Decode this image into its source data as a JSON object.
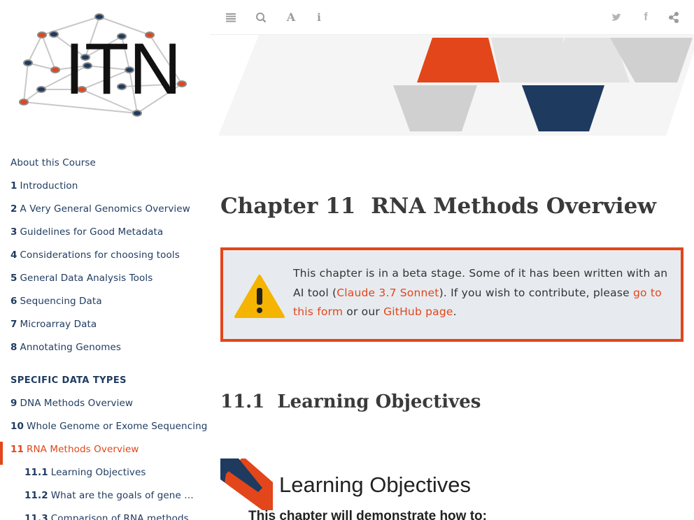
{
  "logo": {
    "text": "ITN"
  },
  "toolbar": {
    "icons": [
      "menu-icon",
      "search-icon",
      "font-icon",
      "info-icon",
      "twitter-icon",
      "facebook-icon",
      "share-icon"
    ],
    "font_glyph": "A",
    "info_glyph": "i",
    "facebook_glyph": "f"
  },
  "toc": {
    "about": "About this Course",
    "items": [
      {
        "num": "1",
        "label": "Introduction"
      },
      {
        "num": "2",
        "label": "A Very General Genomics Overview"
      },
      {
        "num": "3",
        "label": "Guidelines for Good Metadata"
      },
      {
        "num": "4",
        "label": "Considerations for choosing tools"
      },
      {
        "num": "5",
        "label": "General Data Analysis Tools"
      },
      {
        "num": "6",
        "label": "Sequencing Data"
      },
      {
        "num": "7",
        "label": "Microarray Data"
      },
      {
        "num": "8",
        "label": "Annotating Genomes"
      }
    ],
    "section_header": "SPECIFIC DATA TYPES",
    "items2": [
      {
        "num": "9",
        "label": "DNA Methods Overview"
      },
      {
        "num": "10",
        "label": "Whole Genome or Exome Sequencing"
      },
      {
        "num": "11",
        "label": "RNA Methods Overview"
      }
    ],
    "subitems": [
      {
        "num": "11.1",
        "label": "Learning Objectives"
      },
      {
        "num": "11.2",
        "label": "What are the goals of gene expression analysis?"
      },
      {
        "num": "11.3",
        "label": "Comparison of RNA methods"
      }
    ]
  },
  "main": {
    "chapter_prefix": "Chapter 11",
    "chapter_title": "RNA Methods Overview",
    "warning": {
      "text_before": "This chapter is in a beta stage. Some of it has been written with an AI tool (",
      "link1": "Claude 3.7 Sonnet",
      "text_middle": "). If you wish to contribute, please ",
      "link2": "go to this form",
      "text_or": " or our ",
      "link3": "GitHub page",
      "text_end": "."
    },
    "section_num": "11.1",
    "section_title": "Learning Objectives",
    "lo_title": "Learning Objectives",
    "lo_subtitle": "This chapter will demonstrate how to:"
  },
  "colors": {
    "accent": "#e2461a",
    "navy": "#1e3a5f",
    "gray": "#d0d0d0"
  }
}
